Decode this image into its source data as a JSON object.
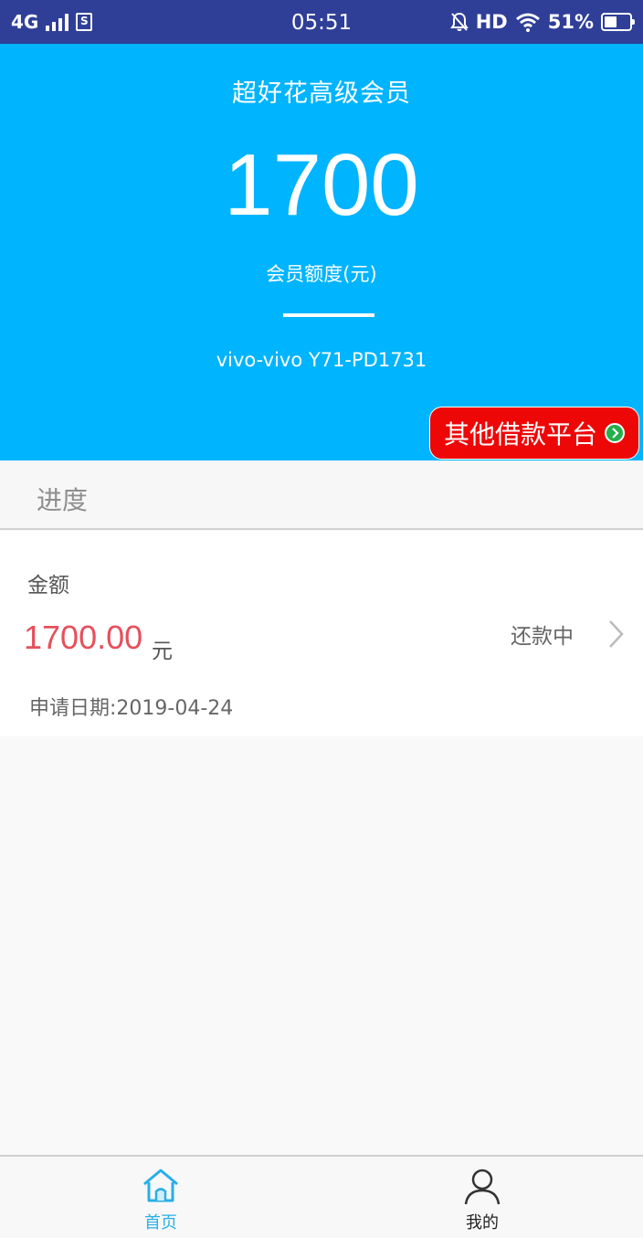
{
  "status_bar": {
    "network": "4G",
    "sim_icon": "S",
    "time": "05:51",
    "hd": "HD",
    "battery": "51%"
  },
  "header": {
    "title": "超好花高级会员",
    "credit_amount": "1700",
    "credit_label": "会员额度(元)",
    "device": "vivo-vivo Y71-PD1731",
    "other_platform_button": "其他借款平台"
  },
  "progress": {
    "section_title": "进度"
  },
  "loan": {
    "amount_label": "金额",
    "amount": "1700.00",
    "unit": "元",
    "status": "还款中",
    "apply_date": "申请日期:2019-04-24"
  },
  "tab_bar": {
    "tabs": [
      {
        "label": "首页",
        "icon": "home-icon",
        "active": true
      },
      {
        "label": "我的",
        "icon": "user-icon",
        "active": false
      }
    ]
  },
  "colors": {
    "header_bg": "#00b4fe",
    "status_bar_bg": "#2f3f98",
    "accent_red": "#ee0707",
    "amount_red": "#e6505c",
    "tab_active": "#29aee8"
  }
}
